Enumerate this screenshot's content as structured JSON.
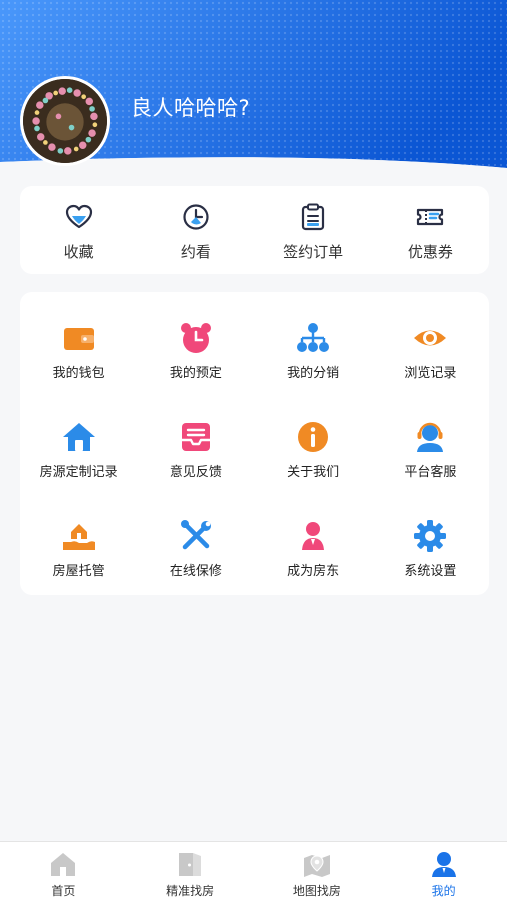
{
  "profile": {
    "username": "良人哈哈哈?"
  },
  "quick_actions": [
    {
      "label": "收藏",
      "icon": "heart-icon"
    },
    {
      "label": "约看",
      "icon": "clock-icon"
    },
    {
      "label": "签约订单",
      "icon": "clipboard-icon"
    },
    {
      "label": "优惠券",
      "icon": "coupon-icon"
    }
  ],
  "tools": [
    {
      "label": "我的钱包",
      "icon": "wallet-icon",
      "color": "#f08a24"
    },
    {
      "label": "我的预定",
      "icon": "alarm-clock-icon",
      "color": "#f0487a"
    },
    {
      "label": "我的分销",
      "icon": "org-chart-icon",
      "color": "#2b8be8"
    },
    {
      "label": "浏览记录",
      "icon": "eye-icon",
      "color": "#f08a24"
    },
    {
      "label": "房源定制记录",
      "icon": "house-icon",
      "color": "#2b8be8"
    },
    {
      "label": "意见反馈",
      "icon": "inbox-icon",
      "color": "#f0487a"
    },
    {
      "label": "关于我们",
      "icon": "info-icon",
      "color": "#f08a24"
    },
    {
      "label": "平台客服",
      "icon": "headset-icon",
      "color": "#2b8be8"
    },
    {
      "label": "房屋托管",
      "icon": "hand-house-icon",
      "color": "#f08a24"
    },
    {
      "label": "在线保修",
      "icon": "wrench-icon",
      "color": "#2b8be8"
    },
    {
      "label": "成为房东",
      "icon": "person-icon",
      "color": "#f0487a"
    },
    {
      "label": "系统设置",
      "icon": "gear-icon",
      "color": "#2b8be8"
    }
  ],
  "tabbar": {
    "items": [
      {
        "label": "首页",
        "icon": "home-icon",
        "active": false
      },
      {
        "label": "精准找房",
        "icon": "door-icon",
        "active": false
      },
      {
        "label": "地图找房",
        "icon": "map-icon",
        "active": false
      },
      {
        "label": "我的",
        "icon": "user-icon",
        "active": true
      }
    ]
  },
  "colors": {
    "accent": "#1a73e8",
    "header_gradient_start": "#3a8dfa",
    "header_gradient_end": "#0d59d6",
    "inactive_tab": "#c8c8c8"
  }
}
